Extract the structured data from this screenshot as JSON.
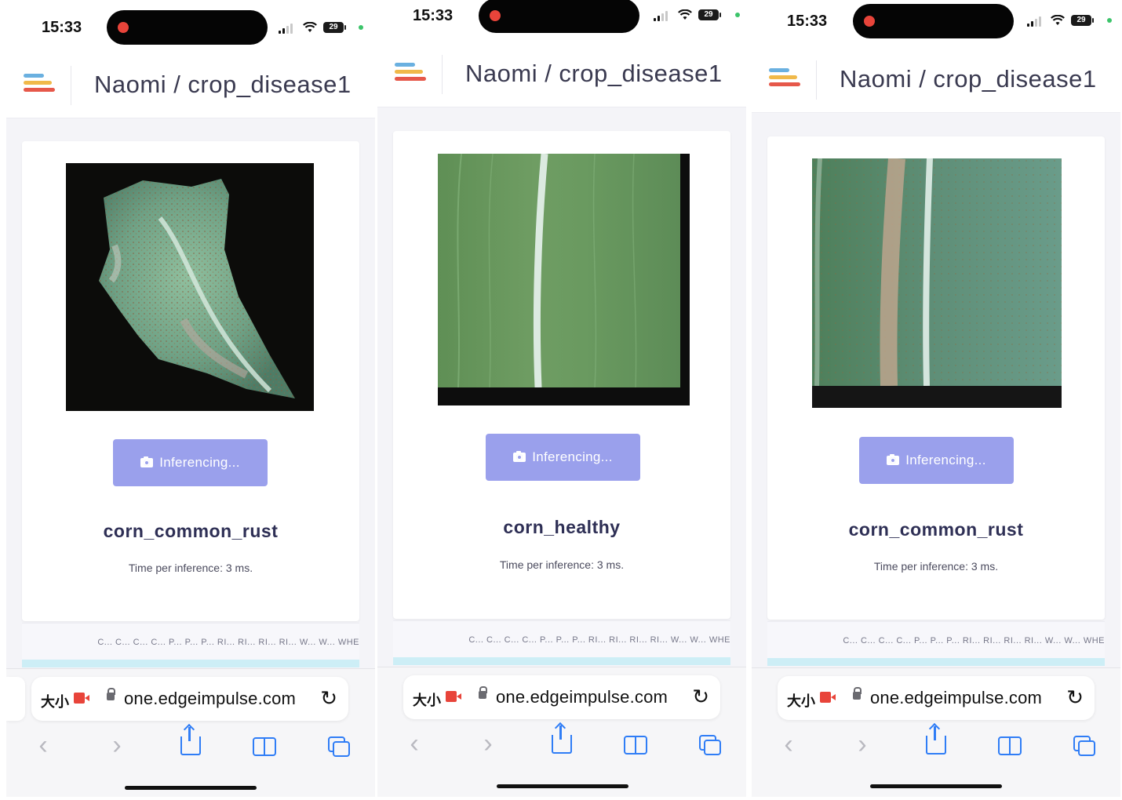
{
  "status": {
    "time": "15:33",
    "battery": "29"
  },
  "header": {
    "title": "Naomi / crop_disease1"
  },
  "inference": {
    "button_label": "Inferencing...",
    "time_text": "Time per inference: 3 ms."
  },
  "strip_columns": "C... C... C... C... P... P... P... RI... RI... RI... RI... W... W... WHE",
  "browser": {
    "text_size_label": "大小",
    "url": "one.edgeimpulse.com"
  },
  "screens": [
    {
      "result": "corn_common_rust"
    },
    {
      "result": "corn_healthy"
    },
    {
      "result": "corn_common_rust"
    }
  ],
  "icons": {
    "logo": "edge-impulse-logo",
    "camera": "camera-icon",
    "lock": "lock-icon",
    "reload": "reload-icon",
    "back": "back-icon",
    "forward": "forward-icon",
    "share": "share-icon",
    "bookmarks": "bookmarks-icon",
    "tabs": "tabs-icon"
  },
  "colors": {
    "button": "#9aa0ec",
    "result_text": "#2e2f55",
    "safari_blue": "#2f7df6",
    "record_red": "#e8443a"
  }
}
